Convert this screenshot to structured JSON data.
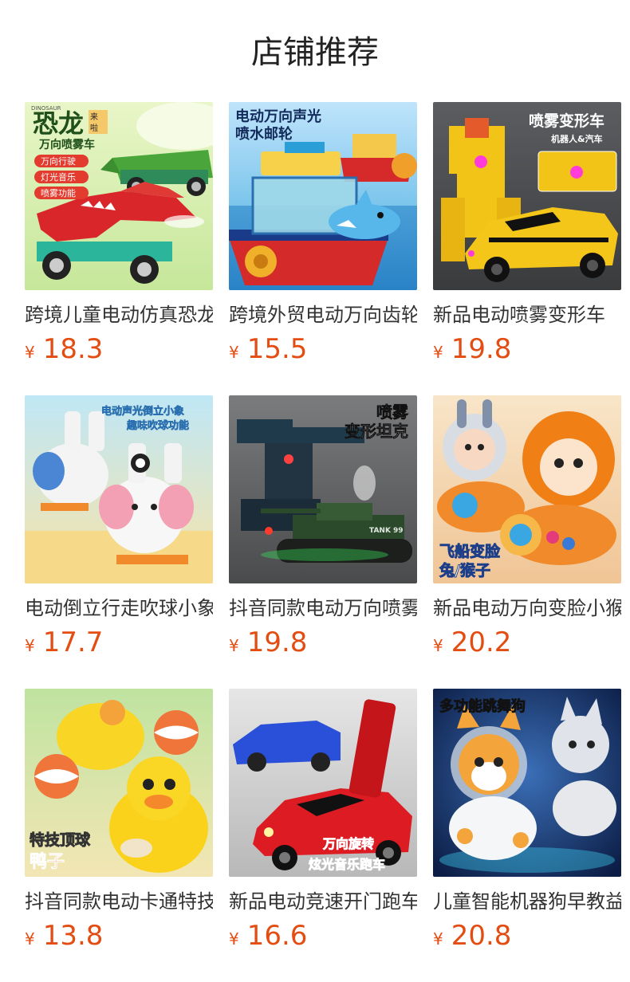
{
  "page": {
    "title": "店铺推荐"
  },
  "products": [
    {
      "name": "跨境儿童电动仿真恐龙",
      "currency": "¥",
      "price": "18.3",
      "image_text": [
        "恐龙",
        "来啦",
        "万向喷雾车",
        "万向行驶",
        "灯光音乐",
        "喷雾功能",
        "DINOSAUR"
      ]
    },
    {
      "name": "跨境外贸电动万向齿轮",
      "currency": "¥",
      "price": "15.5",
      "image_text": [
        "电动万向声光",
        "喷水邮轮"
      ]
    },
    {
      "name": "新品电动喷雾变形车",
      "currency": "¥",
      "price": "19.8",
      "image_text": [
        "喷雾变形车",
        "机器人&汽车"
      ]
    },
    {
      "name": "电动倒立行走吹球小象",
      "currency": "¥",
      "price": "17.7",
      "image_text": [
        "电动声光倒立小象",
        "趣味吹球功能"
      ]
    },
    {
      "name": "抖音同款电动万向喷雾",
      "currency": "¥",
      "price": "19.8",
      "image_text": [
        "喷雾",
        "变形坦克",
        "TANK 99"
      ]
    },
    {
      "name": "新品电动万向变脸小猴",
      "currency": "¥",
      "price": "20.2",
      "image_text": [
        "飞船变脸",
        "兔/猴子"
      ]
    },
    {
      "name": "抖音同款电动卡通特技",
      "currency": "¥",
      "price": "13.8",
      "image_text": [
        "特技顶球",
        "鸭子"
      ]
    },
    {
      "name": "新品电动竞速开门跑车",
      "currency": "¥",
      "price": "16.6",
      "image_text": [
        "万向旋转",
        "炫光音乐跑车"
      ]
    },
    {
      "name": "儿童智能机器狗早教益",
      "currency": "¥",
      "price": "20.8",
      "image_text": [
        "多功能跳舞狗"
      ]
    }
  ],
  "colors": {
    "price": "#e34d12",
    "title": "#222222",
    "name": "#333333"
  }
}
